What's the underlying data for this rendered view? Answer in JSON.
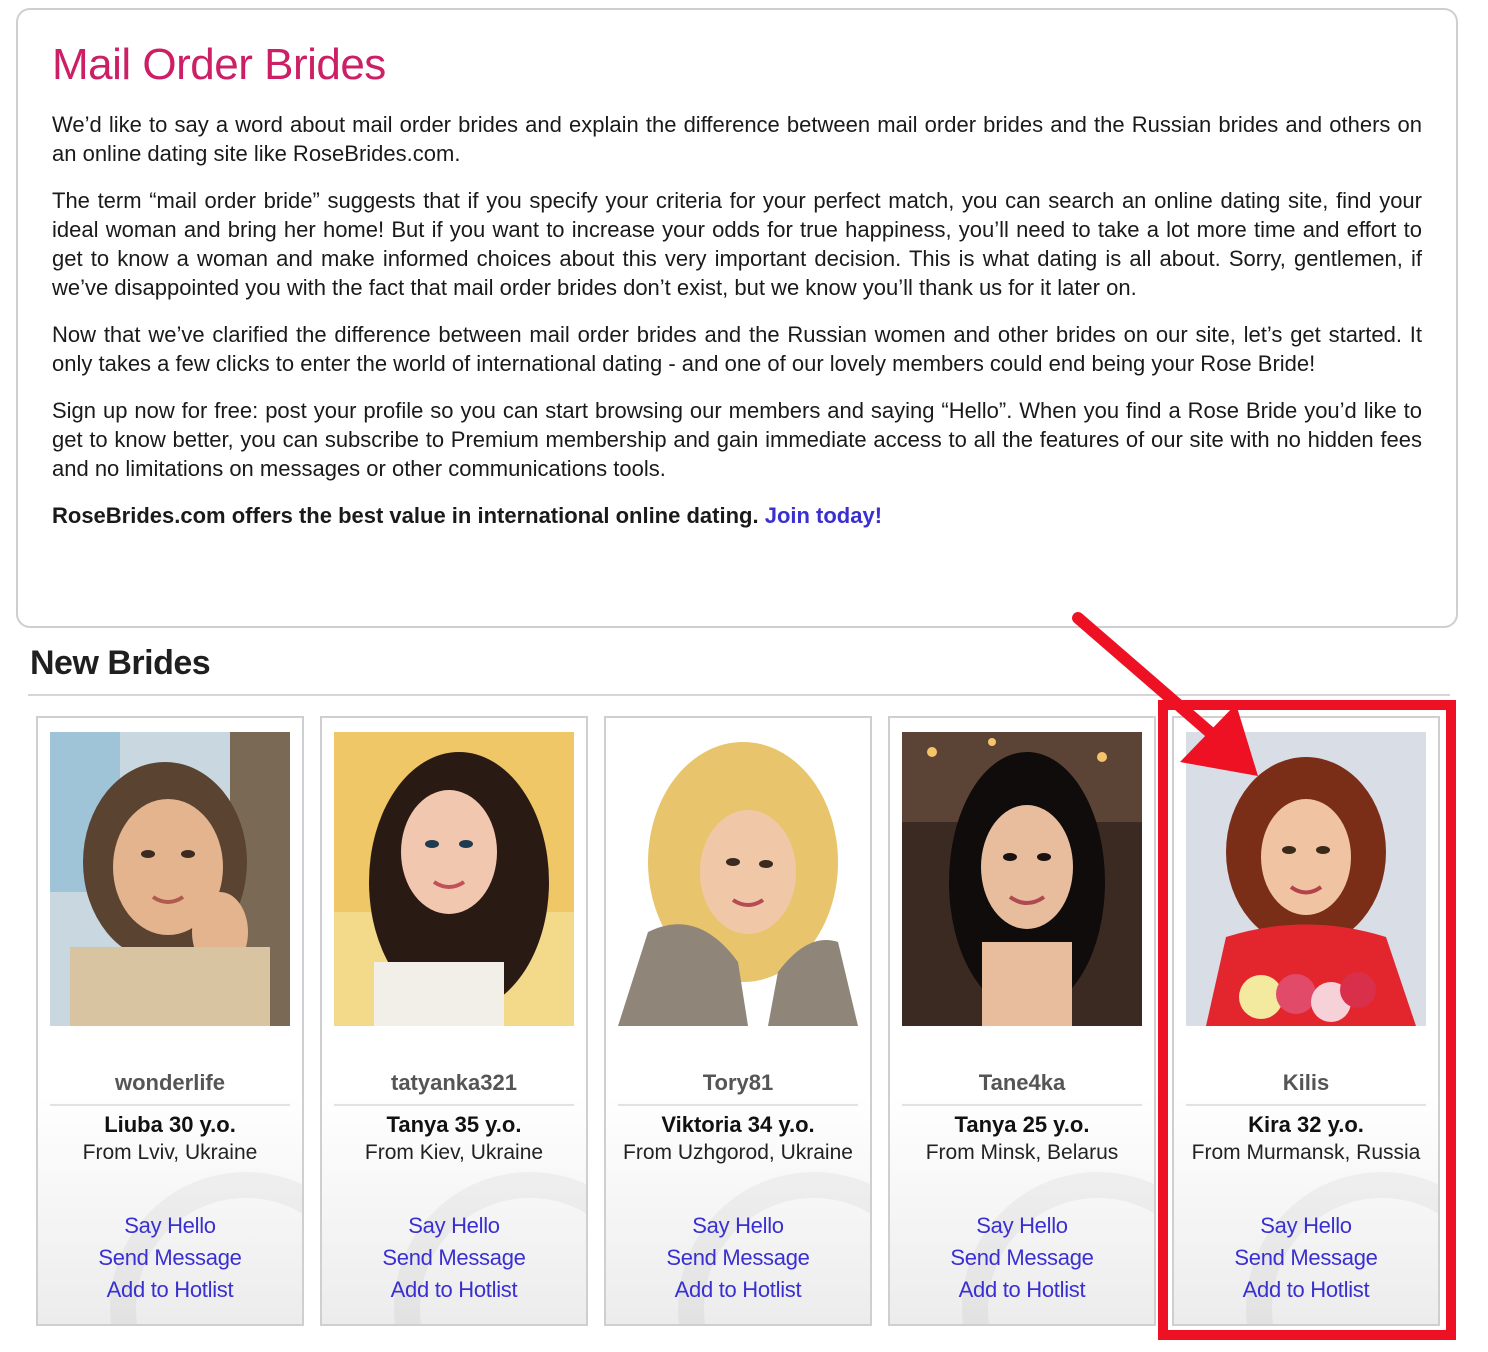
{
  "intro": {
    "title": "Mail Order Brides",
    "paragraphs": [
      "We’d like to say a word about mail order brides and explain the difference between mail order brides and the Russian brides and others on an online dating site like RoseBrides.com.",
      "The term “mail order bride” suggests that if you specify your criteria for your perfect match, you can search an online dating site, find your ideal woman and bring her home! But if you want to increase your odds for true happiness, you’ll need to take a lot more time and effort to get to know a woman and make informed choices about this very important decision. This is what dating is all about. Sorry, gentlemen, if we’ve disappointed you with the fact that mail order brides don’t exist, but we know you’ll thank us for it later on.",
      "Now that we’ve clarified the difference between mail order brides and the Russian women and other brides on our site, let’s get started. It only takes a few clicks to enter the world of international dating - and one of our lovely members could end being your Rose Bride!",
      "Sign up now for free: post your profile so you can start browsing our members and saying “Hello”. When you find a Rose Bride you’d like to get to know better, you can subscribe to Premium membership and gain immediate access to all the features of our site with no hidden fees and no limitations on messages or other communications tools."
    ],
    "closing_text": "RoseBrides.com offers the best value in international online dating.",
    "join_link": "Join today!"
  },
  "section": {
    "title": "New Brides"
  },
  "actions": {
    "say_hello": "Say Hello",
    "send_message": "Send Message",
    "add_hotlist": "Add to Hotlist"
  },
  "brides": [
    {
      "username": "wonderlife",
      "name_age": "Liuba 30 y.o.",
      "location": "From Lviv, Ukraine"
    },
    {
      "username": "tatyanka321",
      "name_age": "Tanya 35 y.o.",
      "location": "From Kiev, Ukraine"
    },
    {
      "username": "Tory81",
      "name_age": "Viktoria 34 y.o.",
      "location": "From Uzhgorod, Ukraine"
    },
    {
      "username": "Tane4ka",
      "name_age": "Tanya 25 y.o.",
      "location": "From Minsk, Belarus"
    },
    {
      "username": "Kilis",
      "name_age": "Kira 32 y.o.",
      "location": "From Murmansk, Russia"
    }
  ],
  "colors": {
    "title": "#cc1f66",
    "link": "#3a2fd1",
    "highlight": "#ee1124"
  }
}
